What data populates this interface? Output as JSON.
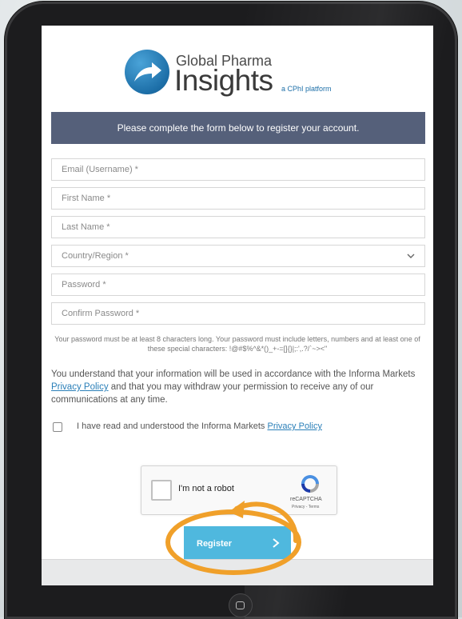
{
  "logo": {
    "line1": "Global Pharma",
    "line2": "Insights",
    "tagline": "a CPhI platform"
  },
  "banner": "Please complete the form below to register your account.",
  "fields": {
    "email": "Email (Username) *",
    "first_name": "First Name *",
    "last_name": "Last Name *",
    "country": "Country/Region *",
    "password": "Password *",
    "confirm_password": "Confirm Password *"
  },
  "password_hint": "Your password must be at least 8 characters long. Your password must include letters, numbers and at least one of these special characters: !@#$%^&*()_+-=[]{}|;:',.?/`~><\"",
  "consent": {
    "prefix": "You understand that your information will be used in accordance with the Informa Markets ",
    "link": "Privacy Policy",
    "suffix": " and that you may withdraw your permission to receive any of our communications at any time."
  },
  "checkbox": {
    "text": "I have read and understood the Informa Markets ",
    "link": "Privacy Policy",
    "checked": false
  },
  "recaptcha": {
    "label": "I'm not a robot",
    "brand": "reCAPTCHA",
    "terms": "Privacy - Terms"
  },
  "register_button": "Register",
  "colors": {
    "banner": "#55607a",
    "register": "#4fb8de",
    "annotation": "#f0a02a",
    "link": "#2a7fb8"
  },
  "icons": {
    "country_dropdown": "chevron-down-icon",
    "register_arrow": "chevron-right-icon",
    "annotation": "circle-with-arrow-highlight"
  }
}
